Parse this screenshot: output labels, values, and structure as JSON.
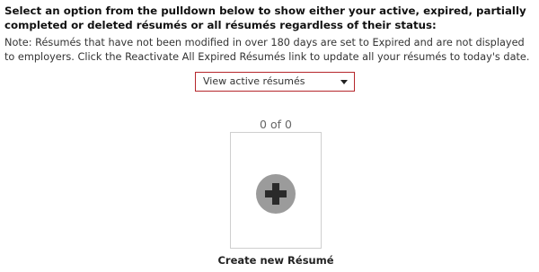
{
  "instructions": "Select an option from the pulldown below to show either your active, expired, partially completed or deleted résumés or all résumés regardless of their status:",
  "note": "Note: Résumés that have not been modified in over 180 days are set to Expired and are not displayed to employers. Click the Reactivate All Expired Résumés link to update all your résumés to today's date.",
  "filter": {
    "selected": "View active résumés",
    "caret_icon": "caret-down-icon"
  },
  "resumes": {
    "count_text": "0 of 0",
    "create_icon": "plus-circle-icon",
    "create_label": "Create new Résumé"
  },
  "colors": {
    "select_border": "#b5262b",
    "plus_circle": "#9b9b9b",
    "plus_sign": "#2a2a2a"
  }
}
